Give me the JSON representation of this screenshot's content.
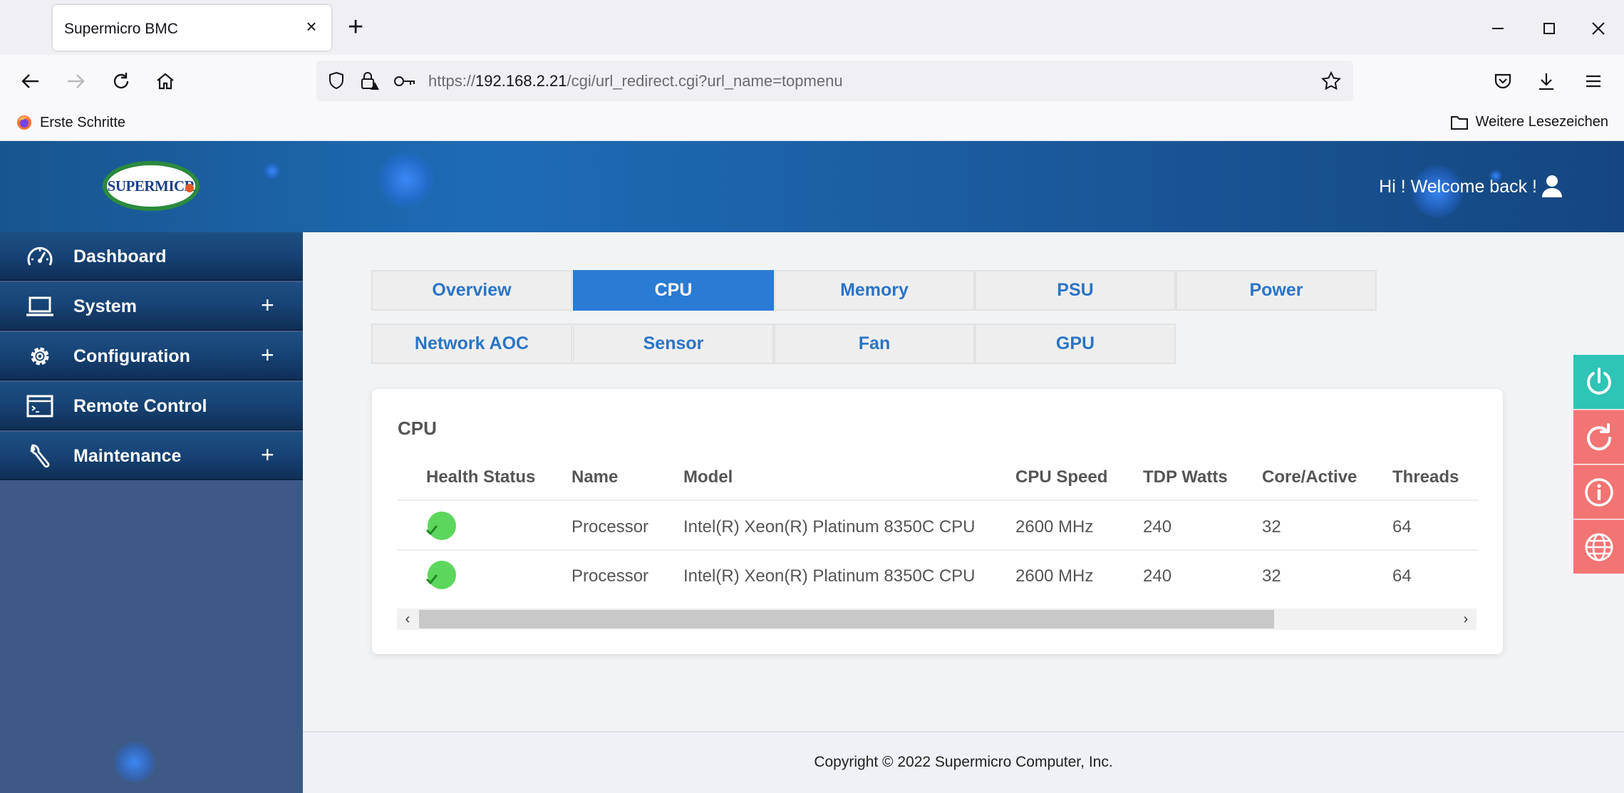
{
  "browser": {
    "tab_title": "Supermicro BMC",
    "tab_close": "×",
    "new_tab": "+",
    "url_scheme": "https://",
    "url_host": "192.168.2.21",
    "url_path": "/cgi/url_redirect.cgi?url_name=topmenu",
    "bookmark_left": "Erste Schritte",
    "bookmark_right": "Weitere Lesezeichen"
  },
  "header": {
    "logo_text": "SUPERMICR",
    "welcome": "Hi ! Welcome back !"
  },
  "sidebar": {
    "items": [
      {
        "label": "Dashboard",
        "expand": ""
      },
      {
        "label": "System",
        "expand": "+"
      },
      {
        "label": "Configuration",
        "expand": "+"
      },
      {
        "label": "Remote Control",
        "expand": ""
      },
      {
        "label": "Maintenance",
        "expand": "+"
      }
    ]
  },
  "tabs": {
    "row1": [
      "Overview",
      "CPU",
      "Memory",
      "PSU",
      "Power"
    ],
    "row2": [
      "Network AOC",
      "Sensor",
      "Fan",
      "GPU"
    ],
    "active": "CPU"
  },
  "cpu_card": {
    "title": "CPU",
    "columns": [
      "Health Status",
      "Name",
      "Model",
      "CPU Speed",
      "TDP Watts",
      "Core/Active",
      "Threads"
    ],
    "rows": [
      {
        "name": "Processor",
        "model": "Intel(R) Xeon(R) Platinum 8350C CPU",
        "speed": "2600 MHz",
        "tdp": "240",
        "cores": "32",
        "threads": "64"
      },
      {
        "name": "Processor",
        "model": "Intel(R) Xeon(R) Platinum 8350C CPU",
        "speed": "2600 MHz",
        "tdp": "240",
        "cores": "32",
        "threads": "64"
      }
    ],
    "scroll_left": "‹",
    "scroll_right": "›"
  },
  "footer": {
    "copyright": "Copyright © 2022 Supermicro Computer, Inc."
  },
  "colors": {
    "accent": "#2a7bd3",
    "power_button": "#2ec4b6",
    "action_button": "#f27474",
    "status_ok": "#5cd65c"
  },
  "icons": {
    "dashboard": "gauge-icon",
    "system": "laptop-icon",
    "configuration": "gear-icon",
    "remote_control": "terminal-window-icon",
    "maintenance": "wrench-icon",
    "float": [
      "power-icon",
      "refresh-icon",
      "info-icon",
      "globe-icon"
    ]
  }
}
